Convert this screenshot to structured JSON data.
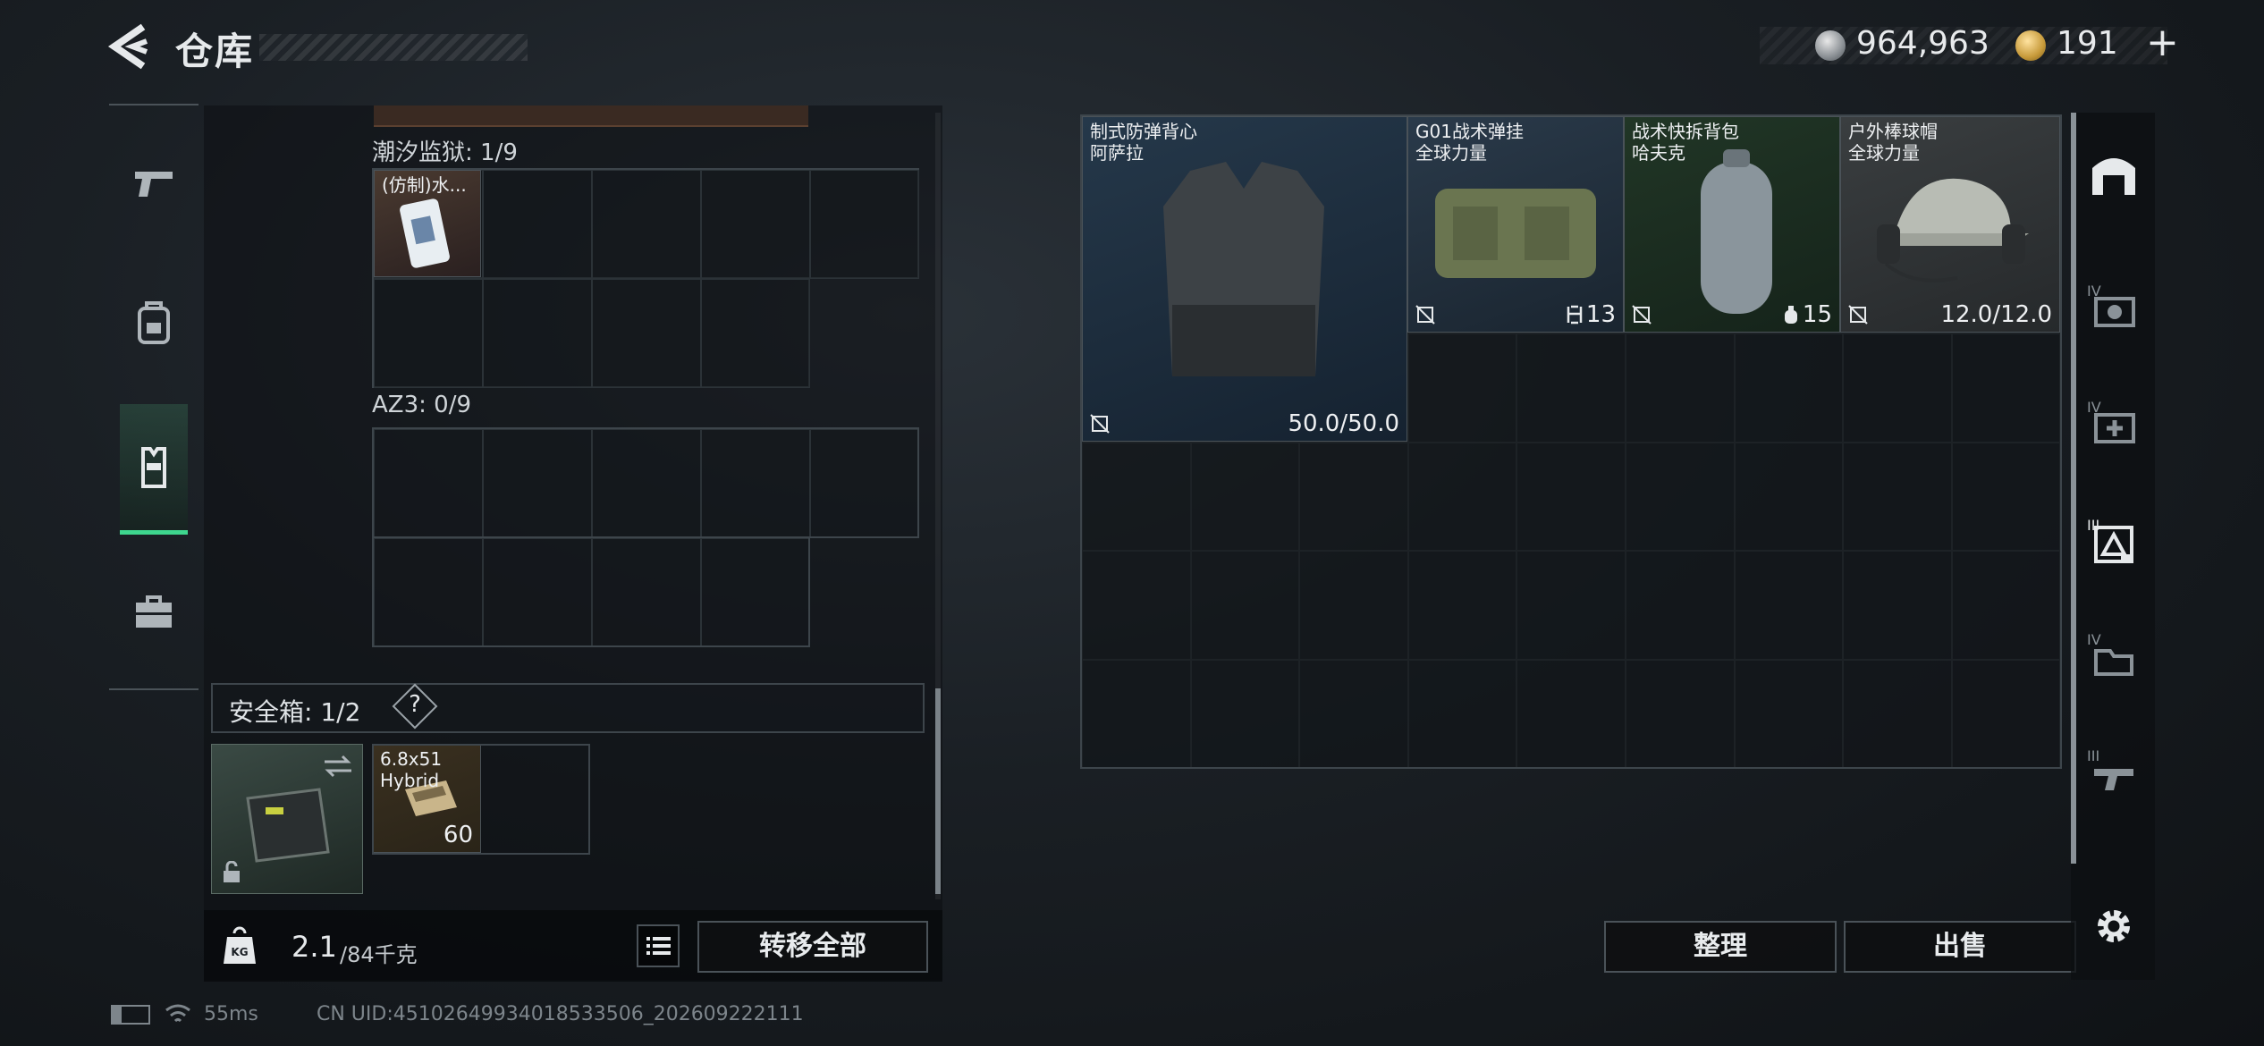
{
  "header": {
    "title": "仓库",
    "back_icon": "chevron-left-icon"
  },
  "currency": {
    "silver": "964,963",
    "gold": "191",
    "add_label": "+"
  },
  "left_tabs": [
    {
      "name": "pistol",
      "icon": "pistol-icon",
      "active": false
    },
    {
      "name": "backpack",
      "icon": "backpack-icon",
      "active": false
    },
    {
      "name": "vest",
      "icon": "vest-icon",
      "active": true
    },
    {
      "name": "briefcase",
      "icon": "briefcase-icon",
      "active": false
    }
  ],
  "containers": [
    {
      "label": "潮汐监狱: 1/9",
      "items": [
        {
          "name": "(仿制)水...",
          "icon": "card-item-icon"
        }
      ]
    },
    {
      "label": "AZ3: 0/9",
      "items": []
    }
  ],
  "safebox": {
    "label": "安全箱: 1/2",
    "help_label": "?",
    "ammo_name": "6.8x51\nHybrid",
    "ammo_count": "60"
  },
  "weight": {
    "current": "2.1",
    "max": "/84千克",
    "kg_label": "KG"
  },
  "buttons": {
    "transfer_all": "转移全部",
    "organize": "整理",
    "sell": "出售"
  },
  "storage_items": [
    {
      "name": "制式防弹背心\n阿萨拉",
      "value": "50.0/50.0",
      "badge": "",
      "color": "#1e2d3b"
    },
    {
      "name": "G01战术弹挂\n全球力量",
      "value": "13",
      "badge": "mag-icon",
      "color": "#243140"
    },
    {
      "name": "战术快拆背包\n哈夫克",
      "value": "15",
      "badge": "bag-icon",
      "color": "#1d2a22"
    },
    {
      "name": "户外棒球帽\n全球力量",
      "value": "12.0/12.0",
      "badge": "",
      "color": "#2f3336"
    }
  ],
  "right_sidebar": [
    {
      "icon": "warehouse-icon",
      "level": ""
    },
    {
      "icon": "weapon-case-icon",
      "level": "IV"
    },
    {
      "icon": "medkit-case-icon",
      "level": "IV"
    },
    {
      "icon": "equipment-case-icon",
      "level": "III"
    },
    {
      "icon": "ammo-case-icon",
      "level": "IV"
    },
    {
      "icon": "gun-case-icon",
      "level": "III"
    },
    {
      "icon": "settings-icon",
      "level": ""
    }
  ],
  "status": {
    "ping": "55ms",
    "uid": "CN UID:45102649934018533506_202609222111"
  }
}
